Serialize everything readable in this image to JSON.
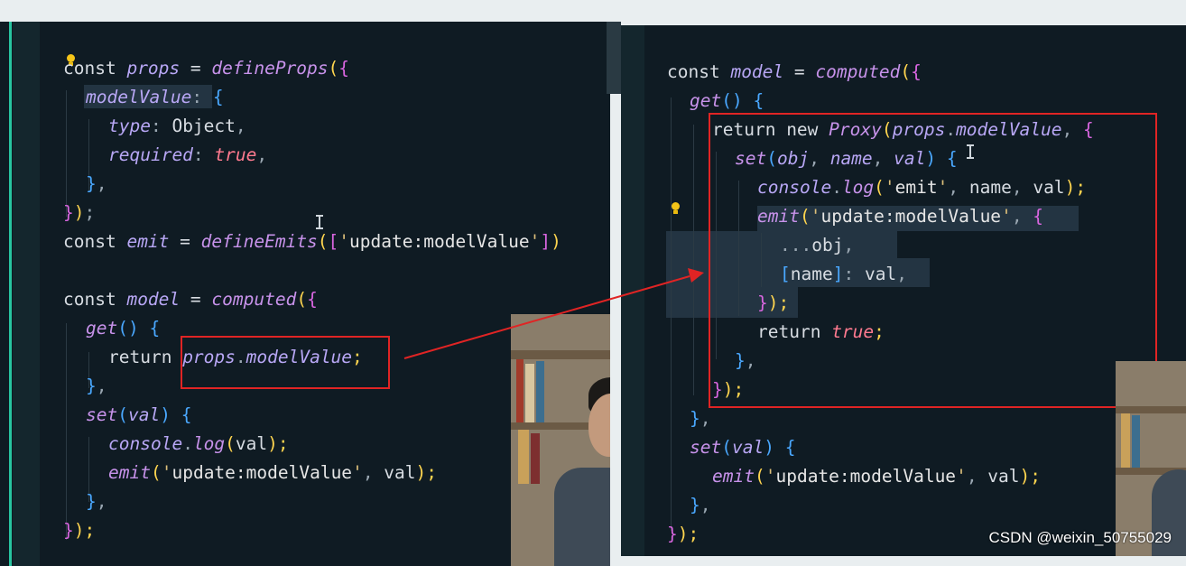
{
  "left_code": {
    "l1": [
      "const ",
      "props",
      " = ",
      "defineProps",
      "(",
      "{"
    ],
    "l2": [
      "modelValue",
      ": ",
      "{"
    ],
    "l3": [
      "type",
      ": ",
      "Object",
      ","
    ],
    "l4": [
      "required",
      ": ",
      "true",
      ","
    ],
    "l5": [
      "}",
      ","
    ],
    "l6": [
      "}",
      ")",
      ";"
    ],
    "l7": [
      "const ",
      "emit",
      " = ",
      "defineEmits",
      "(",
      "[",
      "'",
      "update:modelValue",
      "'",
      "]",
      ")"
    ],
    "l8": [
      "const ",
      "model",
      " = ",
      "computed",
      "(",
      "{"
    ],
    "l9": [
      "get",
      "()",
      " ",
      "{"
    ],
    "l10": [
      "return ",
      "props",
      ".",
      "modelValue",
      ";"
    ],
    "l11": [
      "}",
      ","
    ],
    "l12": [
      "set",
      "(",
      "val",
      ")",
      " ",
      "{"
    ],
    "l13": [
      "console",
      ".",
      "log",
      "(",
      "val",
      ")",
      ";"
    ],
    "l14": [
      "emit",
      "(",
      "'",
      "update:modelValue",
      "'",
      ", ",
      "val",
      ")",
      ";"
    ],
    "l15": [
      "}",
      ","
    ],
    "l16": [
      "}",
      ")",
      ";"
    ]
  },
  "right_code": {
    "r1": [
      "const ",
      "model",
      " = ",
      "computed",
      "(",
      "{"
    ],
    "r2": [
      "get",
      "()",
      " ",
      "{"
    ],
    "r3": [
      "return ",
      "new ",
      "Proxy",
      "(",
      "props",
      ".",
      "modelValue",
      ", ",
      "{"
    ],
    "r4": [
      "set",
      "(",
      "obj",
      ", ",
      "name",
      ", ",
      "val",
      ")",
      " ",
      "{"
    ],
    "r5": [
      "console",
      ".",
      "log",
      "(",
      "'",
      "emit",
      "'",
      ", ",
      "name",
      ", ",
      "val",
      ")",
      ";"
    ],
    "r6": [
      "emit",
      "(",
      "'",
      "update:modelValue",
      "'",
      ", ",
      "{"
    ],
    "r7": [
      "...",
      "obj",
      ","
    ],
    "r8": [
      "[",
      "name",
      "]",
      ": ",
      "val",
      ","
    ],
    "r9": [
      "}",
      ")",
      ";"
    ],
    "r10": [
      "return ",
      "true",
      ";"
    ],
    "r11": [
      "}",
      ","
    ],
    "r12": [
      "}",
      ")",
      ";"
    ],
    "r13": [
      "}",
      ","
    ],
    "r14": [
      "set",
      "(",
      "val",
      ")",
      " ",
      "{"
    ],
    "r15": [
      "emit",
      "(",
      "'",
      "update:modelValue",
      "'",
      ", ",
      "val",
      ")",
      ";"
    ],
    "r16": [
      "}",
      ","
    ],
    "r17": [
      "}",
      ")",
      ";"
    ]
  },
  "watermark": "CSDN @weixin_50755029",
  "colors": {
    "editor_bg": "#0f1b23",
    "highlight_box": "#e02424",
    "arrow": "#e02424"
  }
}
